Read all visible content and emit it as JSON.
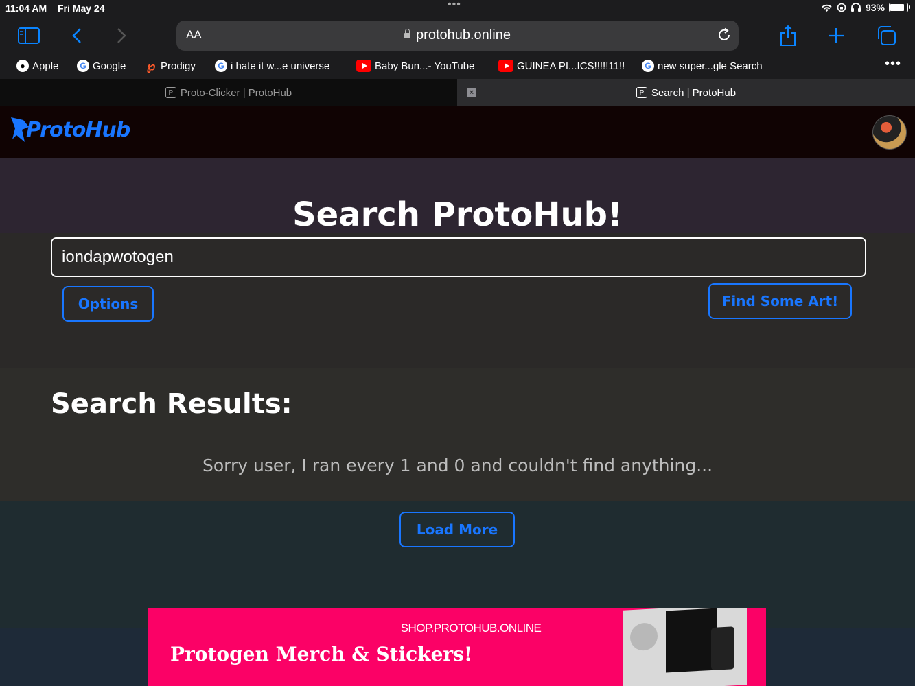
{
  "status_bar": {
    "time": "11:04 AM",
    "date": "Fri May 24",
    "battery": "93%",
    "battery_level": 0.93
  },
  "toolbar": {
    "text_size_label": "AA",
    "url": "protohub.online",
    "icons": [
      "sidebar-icon",
      "back-icon",
      "forward-icon",
      "lock-icon",
      "reload-icon",
      "share-icon",
      "new-tab-icon",
      "tabs-overview-icon"
    ]
  },
  "favorites": [
    {
      "label": "Apple",
      "icon": "apple-icon"
    },
    {
      "label": "Google",
      "icon": "google-icon"
    },
    {
      "label": "Prodigy",
      "icon": "prodigy-icon"
    },
    {
      "label": "i hate it w...e universe",
      "icon": "google-icon"
    },
    {
      "label": "Baby Bun...- YouTube",
      "icon": "youtube-icon"
    },
    {
      "label": "GUINEA PI...ICS!!!!!11!!",
      "icon": "youtube-icon"
    },
    {
      "label": "new super...gle Search",
      "icon": "google-icon"
    }
  ],
  "tabs": [
    {
      "label": "Proto-Clicker | ProtoHub",
      "active": false
    },
    {
      "label": "Search | ProtoHub",
      "active": true
    }
  ],
  "site": {
    "logo": "ProtoHub",
    "page_title": "Search ProtoHub!",
    "search_value": "iondapwotogen",
    "options_label": "Options",
    "find_label": "Find Some Art!",
    "results_title": "Search Results:",
    "no_results": "Sorry user, I ran every 1 and 0 and couldn't find anything...",
    "load_more_label": "Load More",
    "accent_color": "#1976ff"
  },
  "ad": {
    "site": "SHOP.PROTOHUB.ONLINE",
    "headline": "Protogen Merch & Stickers!",
    "background": "#fb0166"
  }
}
